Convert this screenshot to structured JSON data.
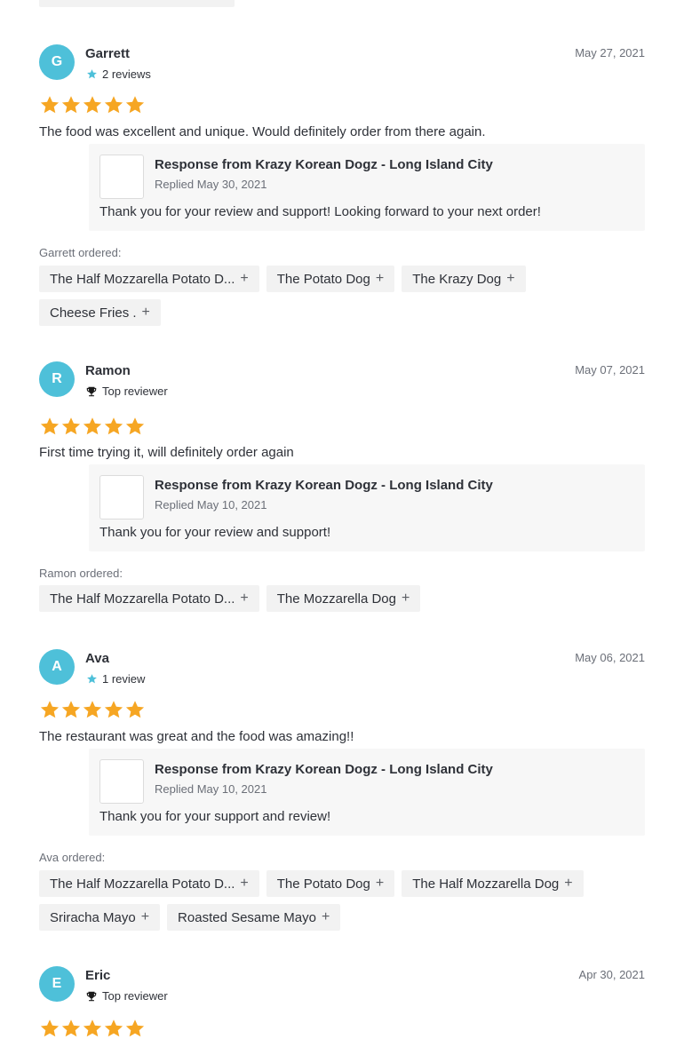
{
  "colors": {
    "avatar": "#4ec0d9",
    "star": "#f6a623",
    "chip_bg": "#f2f2f2",
    "response_bg": "#f7f7f7"
  },
  "reviews": [
    {
      "initial": "G",
      "name": "Garrett",
      "sub_icon": "star-icon",
      "sub_text": "2 reviews",
      "date": "May 27, 2021",
      "rating": 5,
      "text": "The food was excellent and unique. Would definitely order from there again.",
      "response": {
        "title": "Response from Krazy Korean Dogz - Long Island City",
        "date": "Replied May 30, 2021",
        "text": "Thank you for your review and support! Looking forward to your next order!"
      },
      "ordered_label": "Garrett ordered:",
      "items": [
        "The Half Mozzarella Potato D...",
        "The Potato Dog",
        "The Krazy Dog",
        "Cheese Fries ."
      ]
    },
    {
      "initial": "R",
      "name": "Ramon",
      "sub_icon": "trophy-icon",
      "sub_text": "Top reviewer",
      "date": "May 07, 2021",
      "rating": 5,
      "text": "First time trying it, will definitely order again",
      "response": {
        "title": "Response from Krazy Korean Dogz - Long Island City",
        "date": "Replied May 10, 2021",
        "text": "Thank you for your review and support!"
      },
      "ordered_label": "Ramon ordered:",
      "items": [
        "The Half Mozzarella Potato D...",
        "The Mozzarella Dog"
      ]
    },
    {
      "initial": "A",
      "name": "Ava",
      "sub_icon": "star-icon",
      "sub_text": "1 review",
      "date": "May 06, 2021",
      "rating": 5,
      "text": "The restaurant was great and the food was amazing!!",
      "response": {
        "title": "Response from Krazy Korean Dogz - Long Island City",
        "date": "Replied May 10, 2021",
        "text": "Thank you for your support and review!"
      },
      "ordered_label": "Ava ordered:",
      "items": [
        "The Half Mozzarella Potato D...",
        "The Potato Dog",
        "The Half Mozzarella Dog",
        "Sriracha Mayo",
        "Roasted Sesame Mayo"
      ]
    },
    {
      "initial": "E",
      "name": "Eric",
      "sub_icon": "trophy-icon",
      "sub_text": "Top reviewer",
      "date": "Apr 30, 2021",
      "rating": 5
    }
  ]
}
